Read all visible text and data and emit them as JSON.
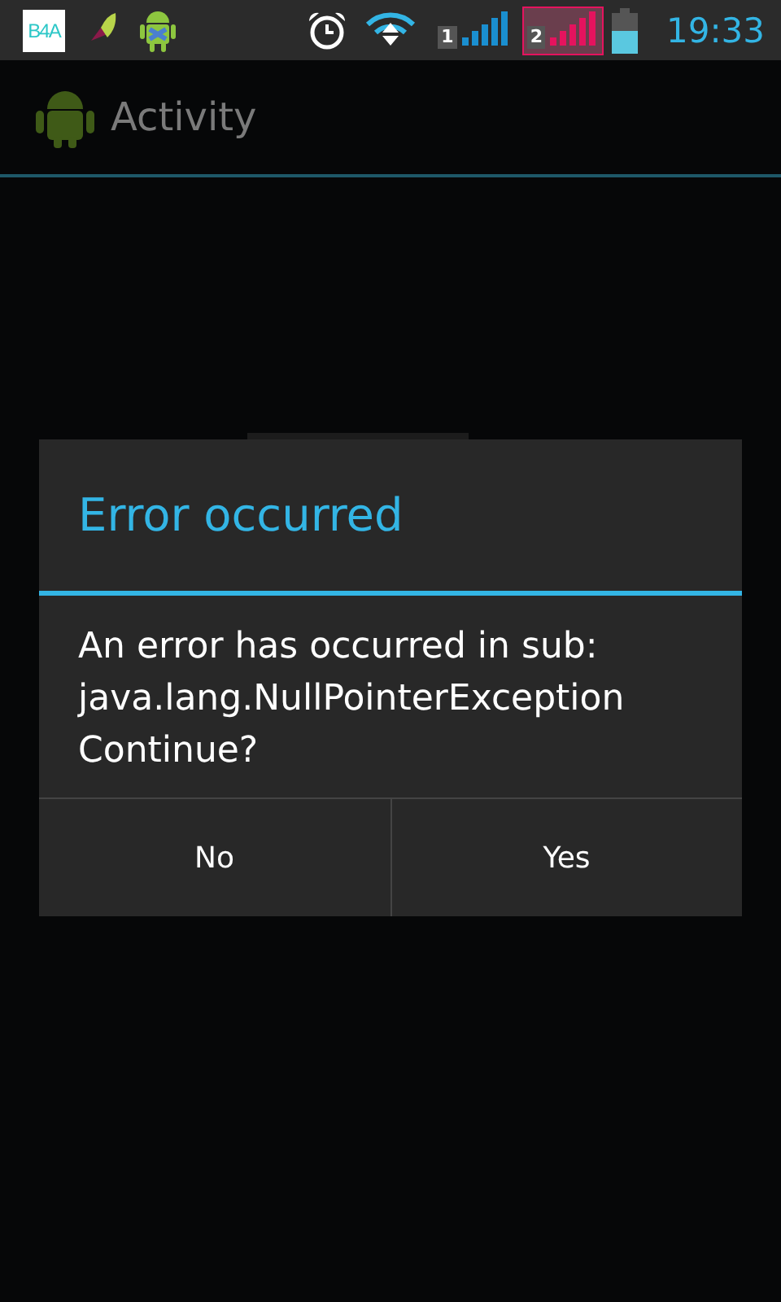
{
  "status_bar": {
    "notifications": [
      {
        "kind": "b4a",
        "label": "B4A"
      },
      {
        "kind": "leaf"
      },
      {
        "kind": "android"
      }
    ],
    "sims": [
      {
        "label": "1",
        "color": "#1a8fd0",
        "selected": false
      },
      {
        "label": "2",
        "color": "#e5135e",
        "selected": true
      }
    ],
    "time": "19:33"
  },
  "action_bar": {
    "title": "Activity"
  },
  "dialog": {
    "title": "Error occurred",
    "message": "An error has occurred in sub:\njava.lang.NullPointerException\nContinue?",
    "buttons": [
      "No",
      "Yes"
    ]
  }
}
